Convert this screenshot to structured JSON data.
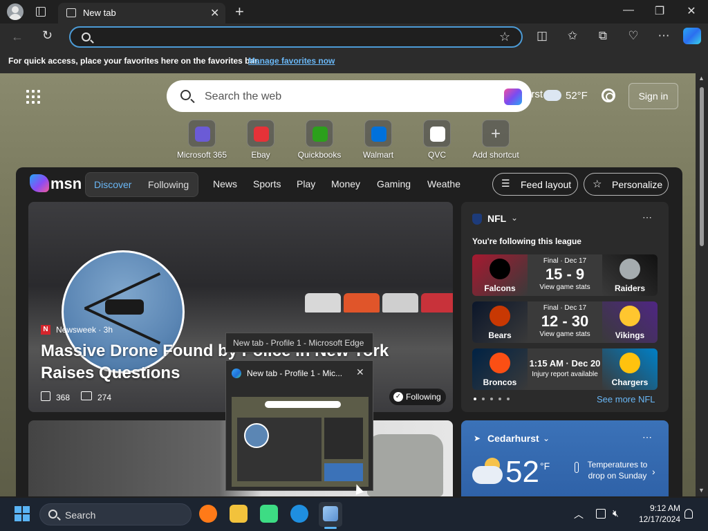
{
  "browser": {
    "tab_title": "New tab",
    "address_value": "",
    "favorites_bar": {
      "text": "For quick access, place your favorites here on the favorites bar.",
      "link": "Manage favorites now"
    }
  },
  "newtab": {
    "search_placeholder": "Search the web",
    "weather_location_short": "urst",
    "weather_temp": "52°F",
    "signin_label": "Sign in",
    "shortcuts": [
      {
        "label": "Microsoft 365",
        "color": "#6b5bd6"
      },
      {
        "label": "Ebay",
        "color": "#e53238"
      },
      {
        "label": "Quickbooks",
        "color": "#2ca01c"
      },
      {
        "label": "Walmart",
        "color": "#0071dc"
      },
      {
        "label": "QVC",
        "color": "#ffffff"
      },
      {
        "label": "Add shortcut",
        "color": "#888888"
      }
    ]
  },
  "feed": {
    "brand": "msn",
    "pill": {
      "discover": "Discover",
      "following": "Following"
    },
    "nav": [
      "News",
      "Sports",
      "Play",
      "Money",
      "Gaming",
      "Weathe"
    ],
    "feed_layout_label": "Feed layout",
    "personalize_label": "Personalize",
    "hero": {
      "source_badge": "N",
      "source": "Newsweek · 3h",
      "title": "Massive Drone Found by Police in New York Raises Questions",
      "likes": "368",
      "comments": "274",
      "following_label": "Following"
    }
  },
  "nfl": {
    "title": "NFL",
    "subtitle": "You're following this league",
    "games": [
      {
        "left_team": "Falcons",
        "right_team": "Raiders",
        "status": "Final · Dec 17",
        "score": "15 - 9",
        "meta": "View game stats",
        "left_color": "#a71930",
        "right_color": "#111111"
      },
      {
        "left_team": "Bears",
        "right_team": "Vikings",
        "status": "Final · Dec 17",
        "score": "12 - 30",
        "meta": "View game stats",
        "left_color": "#0b162a",
        "right_color": "#4f2683"
      },
      {
        "left_team": "Broncos",
        "right_team": "Chargers",
        "status": "",
        "score": "1:15 AM · Dec 20",
        "meta": "Injury report available",
        "left_color": "#002244",
        "right_color": "#0080c6"
      }
    ],
    "see_more": "See more NFL"
  },
  "weather_card": {
    "location": "Cedarhurst",
    "temp": "52",
    "unit": "°F",
    "message": "Temperatures to drop on Sunday"
  },
  "taskbar_preview": {
    "tooltip": "New tab - Profile 1 - Microsoft Edge",
    "title": "New tab - Profile 1 - Mic..."
  },
  "taskbar": {
    "search_label": "Search",
    "time": "9:12 AM",
    "date": "12/17/2024",
    "apps": [
      {
        "name": "firefox-icon",
        "color": "#ff7a18"
      },
      {
        "name": "file-explorer-icon",
        "color": "#f2c23c"
      },
      {
        "name": "android-studio-icon",
        "color": "#3ddc84"
      },
      {
        "name": "edge-icon",
        "color": "#1f8fe0"
      }
    ]
  }
}
